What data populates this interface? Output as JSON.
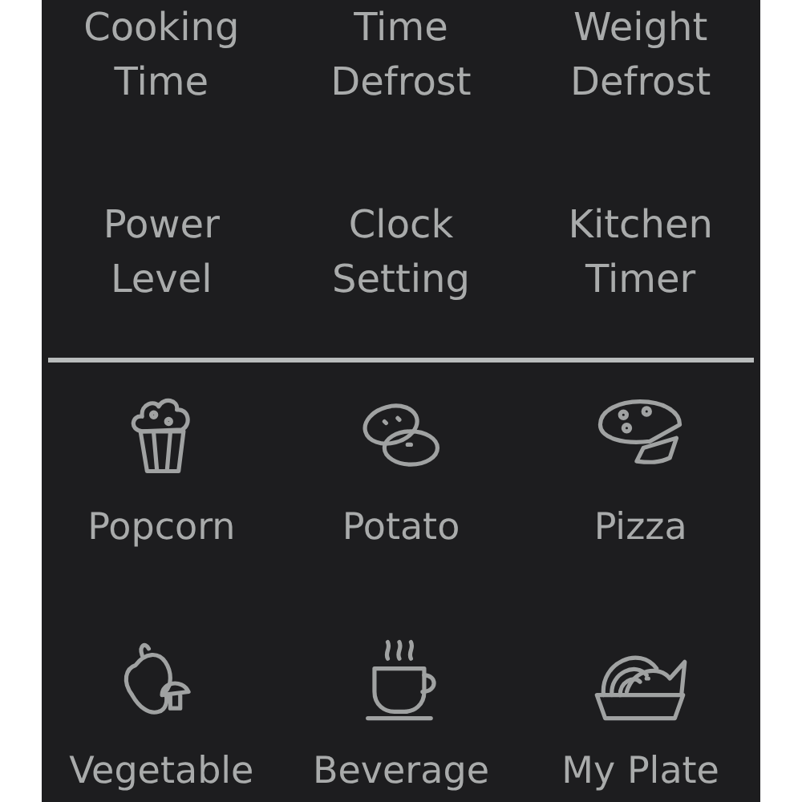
{
  "setting_buttons": [
    {
      "label": "Cooking Time"
    },
    {
      "label": "Time Defrost"
    },
    {
      "label": "Weight Defrost"
    },
    {
      "label": "Power Level"
    },
    {
      "label": "Clock Setting"
    },
    {
      "label": "Kitchen Timer"
    }
  ],
  "food_buttons": [
    {
      "label": "Popcorn"
    },
    {
      "label": "Potato"
    },
    {
      "label": "Pizza"
    },
    {
      "label": "Vegetable"
    },
    {
      "label": "Beverage"
    },
    {
      "label": "My Plate"
    }
  ]
}
